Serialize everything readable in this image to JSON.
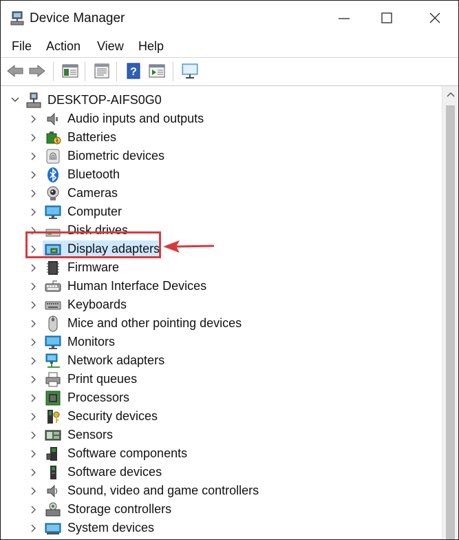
{
  "window": {
    "title": "Device Manager"
  },
  "menu": [
    "File",
    "Action",
    "View",
    "Help"
  ],
  "toolbar": {
    "buttons": [
      "back-icon",
      "forward-icon",
      "show-hide-console-tree-icon",
      "properties-icon",
      "help-icon",
      "run-icon",
      "scan-hardware-icon"
    ]
  },
  "tree": {
    "root": "DESKTOP-AIFS0G0",
    "items": [
      {
        "label": "Audio inputs and outputs",
        "icon": "speaker-icon"
      },
      {
        "label": "Batteries",
        "icon": "battery-icon"
      },
      {
        "label": "Biometric devices",
        "icon": "fingerprint-icon"
      },
      {
        "label": "Bluetooth",
        "icon": "bluetooth-icon"
      },
      {
        "label": "Cameras",
        "icon": "camera-icon"
      },
      {
        "label": "Computer",
        "icon": "computer-icon"
      },
      {
        "label": "Disk drives",
        "icon": "disk-drive-icon"
      },
      {
        "label": "Display adapters",
        "icon": "display-adapter-icon",
        "selected": true
      },
      {
        "label": "Firmware",
        "icon": "chip-icon"
      },
      {
        "label": "Human Interface Devices",
        "icon": "hid-icon"
      },
      {
        "label": "Keyboards",
        "icon": "keyboard-icon"
      },
      {
        "label": "Mice and other pointing devices",
        "icon": "mouse-icon"
      },
      {
        "label": "Monitors",
        "icon": "monitor-icon"
      },
      {
        "label": "Network adapters",
        "icon": "network-icon"
      },
      {
        "label": "Print queues",
        "icon": "printer-icon"
      },
      {
        "label": "Processors",
        "icon": "processor-icon"
      },
      {
        "label": "Security devices",
        "icon": "security-icon"
      },
      {
        "label": "Sensors",
        "icon": "sensor-icon"
      },
      {
        "label": "Software components",
        "icon": "software-component-icon"
      },
      {
        "label": "Software devices",
        "icon": "software-device-icon"
      },
      {
        "label": "Sound, video and game controllers",
        "icon": "sound-icon"
      },
      {
        "label": "Storage controllers",
        "icon": "storage-icon"
      },
      {
        "label": "System devices",
        "icon": "system-icon"
      }
    ]
  },
  "colors": {
    "highlight_box": "#d9393e",
    "selection": "#cce8ff",
    "monitor_blue": "#1e90d6"
  }
}
